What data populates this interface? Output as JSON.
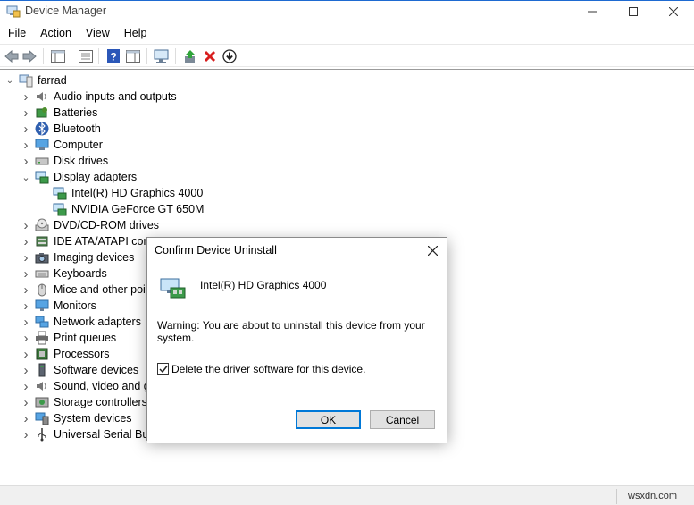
{
  "window": {
    "title": "Device Manager"
  },
  "menubar": {
    "items": [
      "File",
      "Action",
      "View",
      "Help"
    ]
  },
  "toolbar": {
    "buttons": [
      "back-arrow-icon",
      "forward-arrow-icon",
      "show-hide-console-tree-icon",
      "properties-icon",
      "help-icon",
      "action-pane-icon",
      "monitor-scan-icon",
      "update-driver-icon",
      "uninstall-device-icon",
      "disable-device-icon"
    ]
  },
  "tree": {
    "root": "farrad",
    "items": [
      {
        "label": "Audio inputs and outputs",
        "icon": "speaker-icon"
      },
      {
        "label": "Batteries",
        "icon": "battery-icon"
      },
      {
        "label": "Bluetooth",
        "icon": "bluetooth-icon"
      },
      {
        "label": "Computer",
        "icon": "computer-icon"
      },
      {
        "label": "Disk drives",
        "icon": "disk-drive-icon"
      },
      {
        "label": "Display adapters",
        "icon": "display-adapter-icon",
        "expanded": true,
        "children": [
          {
            "label": "Intel(R) HD Graphics 4000",
            "icon": "display-adapter-icon"
          },
          {
            "label": "NVIDIA GeForce GT 650M",
            "icon": "display-adapter-icon"
          }
        ]
      },
      {
        "label": "DVD/CD-ROM drives",
        "icon": "dvd-drive-icon"
      },
      {
        "label": "IDE ATA/ATAPI cont",
        "icon": "ide-controller-icon"
      },
      {
        "label": "Imaging devices",
        "icon": "camera-icon"
      },
      {
        "label": "Keyboards",
        "icon": "keyboard-icon"
      },
      {
        "label": "Mice and other poi",
        "icon": "mouse-icon"
      },
      {
        "label": "Monitors",
        "icon": "monitor-icon"
      },
      {
        "label": "Network adapters",
        "icon": "network-adapter-icon"
      },
      {
        "label": "Print queues",
        "icon": "printer-icon"
      },
      {
        "label": "Processors",
        "icon": "processor-icon"
      },
      {
        "label": "Software devices",
        "icon": "software-device-icon"
      },
      {
        "label": "Sound, video and g",
        "icon": "sound-icon"
      },
      {
        "label": "Storage controllers",
        "icon": "storage-controller-icon"
      },
      {
        "label": "System devices",
        "icon": "system-device-icon"
      },
      {
        "label": "Universal Serial Bus",
        "icon": "usb-icon"
      }
    ]
  },
  "dialog": {
    "title": "Confirm Device Uninstall",
    "device_name": "Intel(R) HD Graphics 4000",
    "warning": "Warning: You are about to uninstall this device from your system.",
    "checkbox_label": "Delete the driver software for this device.",
    "checkbox_checked": true,
    "ok_label": "OK",
    "cancel_label": "Cancel"
  },
  "statusbar": {
    "watermark": "wsxdn.com"
  },
  "colors": {
    "accent": "#0078d7",
    "title_border": "#1e6ad1",
    "uninstall_red": "#d81e1e"
  }
}
